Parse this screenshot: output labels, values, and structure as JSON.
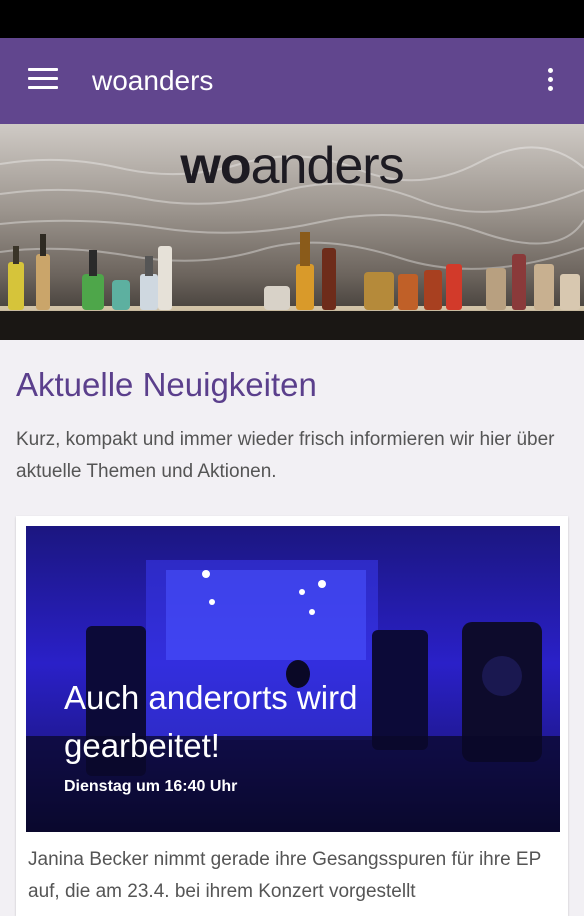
{
  "app_bar": {
    "title": "woanders",
    "menu_icon": "hamburger-menu-icon",
    "overflow_icon": "more-vert-icon",
    "color": "#61468e"
  },
  "hero": {
    "logo_bold": "wo",
    "logo_regular": "anders"
  },
  "news": {
    "title": "Aktuelle Neuigkeiten",
    "intro": "Kurz, kompakt und immer wieder frisch informieren wir hier über aktuelle Themen und Aktionen.",
    "title_color": "#5b3f8c"
  },
  "card": {
    "headline": "Auch anderorts wird gearbeitet!",
    "date": "Dienstag um 16:40 Uhr",
    "text": "Janina Becker nimmt gerade ihre Gesangsspuren für ihre EP auf, die am 23.4. bei ihrem Konzert vorgestellt"
  }
}
